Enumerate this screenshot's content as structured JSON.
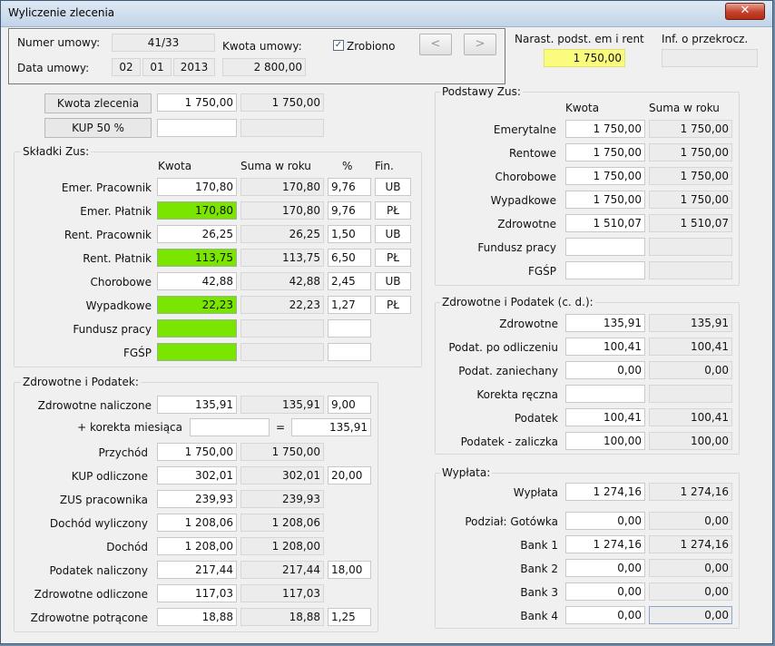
{
  "window": {
    "title": "Wyliczenie zlecenia",
    "close_glyph": "✕"
  },
  "header": {
    "numer_label": "Numer umowy:",
    "numer_value": "41/33",
    "data_label": "Data umowy:",
    "day": "02",
    "month": "01",
    "year": "2013",
    "kwota_label": "Kwota umowy:",
    "kwota_value": "2 800,00",
    "zrobiono_label": "Zrobiono",
    "zrobiono_checked": "✓",
    "prev": "<",
    "next": ">",
    "narast_label": "Narast. podst. em i rent",
    "narast_value": "1 750,00",
    "inf_label": "Inf. o przekrocz.",
    "inf_value": ""
  },
  "top": {
    "kwota_zlecenia_label": "Kwota zlecenia",
    "kwota_zlecenia_value": "1 750,00",
    "kwota_zlecenia_sum": "1 750,00",
    "kup_label": "KUP 50 %",
    "kup_value": "",
    "kup_sum": ""
  },
  "skladki": {
    "title": "Składki Zus:",
    "col_kwota": "Kwota",
    "col_suma": "Suma w roku",
    "col_pct": "%",
    "col_fin": "Fin.",
    "rows": [
      {
        "label": "Emer. Pracownik",
        "kwota": "170,80",
        "suma": "170,80",
        "pct": "9,76",
        "fin": "UB"
      },
      {
        "label": "Emer. Płatnik",
        "kwota": "170,80",
        "suma": "170,80",
        "pct": "9,76",
        "fin": "PŁ"
      },
      {
        "label": "Rent. Pracownik",
        "kwota": "26,25",
        "suma": "26,25",
        "pct": "1,50",
        "fin": "UB"
      },
      {
        "label": "Rent. Płatnik",
        "kwota": "113,75",
        "suma": "113,75",
        "pct": "6,50",
        "fin": "PŁ"
      },
      {
        "label": "Chorobowe",
        "kwota": "42,88",
        "suma": "42,88",
        "pct": "2,45",
        "fin": "UB"
      },
      {
        "label": "Wypadkowe",
        "kwota": "22,23",
        "suma": "22,23",
        "pct": "1,27",
        "fin": "PŁ"
      },
      {
        "label": "Fundusz pracy",
        "kwota": "",
        "suma": "",
        "pct": "",
        "fin": ""
      },
      {
        "label": "FGŚP",
        "kwota": "",
        "suma": "",
        "pct": "",
        "fin": ""
      }
    ]
  },
  "zdrowotne": {
    "title": "Zdrowotne i Podatek:",
    "naliczone_label": "Zdrowotne naliczone",
    "naliczone_value": "135,91",
    "naliczone_sum": "135,91",
    "naliczone_pct": "9,00",
    "korekta_label": "+ korekta miesiąca",
    "korekta_value": "",
    "eq": "=",
    "korekta_result": "135,91",
    "rows": [
      {
        "label": "Przychód",
        "value": "1 750,00",
        "sum": "1 750,00",
        "pct": ""
      },
      {
        "label": "KUP odliczone",
        "value": "302,01",
        "sum": "302,01",
        "pct": "20,00"
      },
      {
        "label": "ZUS pracownika",
        "value": "239,93",
        "sum": "239,93",
        "pct": ""
      },
      {
        "label": "Dochód wyliczony",
        "value": "1 208,06",
        "sum": "1 208,06",
        "pct": ""
      },
      {
        "label": "Dochód",
        "value": "1 208,00",
        "sum": "1 208,00",
        "pct": ""
      },
      {
        "label": "Podatek naliczony",
        "value": "217,44",
        "sum": "217,44",
        "pct": "18,00"
      },
      {
        "label": "Zdrowotne odliczone",
        "value": "117,03",
        "sum": "117,03",
        "pct": ""
      },
      {
        "label": "Zdrowotne potrącone",
        "value": "18,88",
        "sum": "18,88",
        "pct": "1,25"
      }
    ]
  },
  "podstawy": {
    "title": "Podstawy Zus:",
    "col_kwota": "Kwota",
    "col_suma": "Suma w roku",
    "rows": [
      {
        "label": "Emerytalne",
        "kwota": "1 750,00",
        "suma": "1 750,00"
      },
      {
        "label": "Rentowe",
        "kwota": "1 750,00",
        "suma": "1 750,00"
      },
      {
        "label": "Chorobowe",
        "kwota": "1 750,00",
        "suma": "1 750,00"
      },
      {
        "label": "Wypadkowe",
        "kwota": "1 750,00",
        "suma": "1 750,00"
      },
      {
        "label": "Zdrowotne",
        "kwota": "1 510,07",
        "suma": "1 510,07"
      },
      {
        "label": "Fundusz pracy",
        "kwota": "",
        "suma": ""
      },
      {
        "label": "FGŚP",
        "kwota": "",
        "suma": ""
      }
    ]
  },
  "zdrowotne_cd": {
    "title": "Zdrowotne i Podatek (c. d.):",
    "rows": [
      {
        "label": "Zdrowotne",
        "value": "135,91",
        "sum": "135,91"
      },
      {
        "label": "Podat. po odliczeniu",
        "value": "100,41",
        "sum": "100,41"
      },
      {
        "label": "Podat. zaniechany",
        "value": "0,00",
        "sum": "0,00"
      },
      {
        "label": "Korekta ręczna",
        "value": "",
        "sum": ""
      },
      {
        "label": "Podatek",
        "value": "100,41",
        "sum": "100,41"
      },
      {
        "label": "Podatek - zaliczka",
        "value": "100,00",
        "sum": "100,00"
      }
    ]
  },
  "wyplata": {
    "title": "Wypłata:",
    "wyplata_label": "Wypłata",
    "wyplata_value": "1 274,16",
    "wyplata_sum": "1 274,16",
    "podzial_label": "Podział:  Gotówka",
    "gotowka_value": "0,00",
    "gotowka_sum": "0,00",
    "banks": [
      {
        "label": "Bank 1",
        "value": "1 274,16",
        "sum": "1 274,16"
      },
      {
        "label": "Bank 2",
        "value": "0,00",
        "sum": "0,00"
      },
      {
        "label": "Bank 3",
        "value": "0,00",
        "sum": "0,00"
      },
      {
        "label": "Bank 4",
        "value": "0,00",
        "sum": "0,00"
      }
    ]
  },
  "colors": {
    "green": "#7ae600",
    "yellow": "#fbfb7d"
  }
}
